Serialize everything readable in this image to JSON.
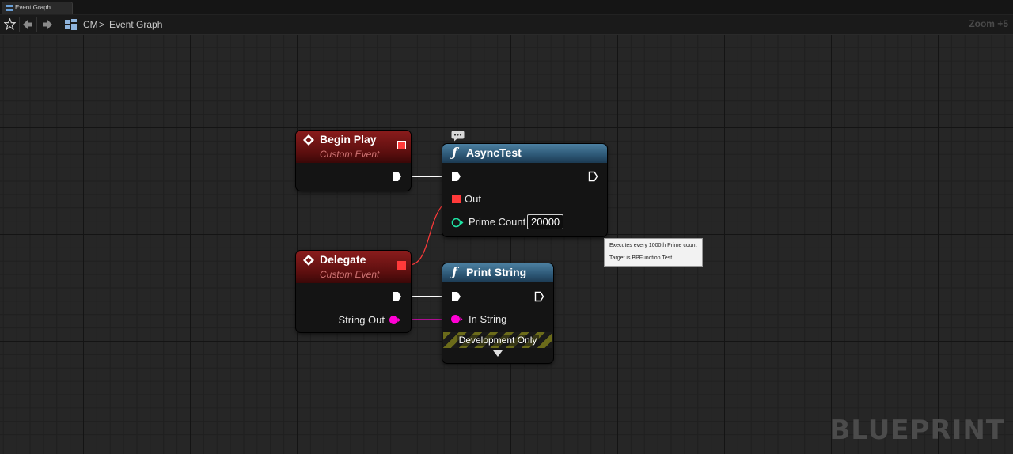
{
  "tab": {
    "label": "Event Graph"
  },
  "breadcrumb": {
    "root": "CM",
    "separator": ">",
    "current": "Event Graph"
  },
  "zoom": "Zoom +5",
  "watermark": "BLUEPRINT",
  "nodes": {
    "begin_play": {
      "title": "Begin Play",
      "subtitle": "Custom Event"
    },
    "delegate": {
      "title": "Delegate",
      "subtitle": "Custom Event",
      "string_out": "String Out"
    },
    "async_test": {
      "title": "AsyncTest",
      "out_label": "Out",
      "prime_count_label": "Prime Count",
      "prime_count_value": "20000"
    },
    "print_string": {
      "title": "Print String",
      "in_string_label": "In String",
      "dev_only": "Development Only"
    }
  },
  "tooltip": {
    "line1": "Executes every 1000th Prime count",
    "line2": "Target is BPFunction Test"
  },
  "colors": {
    "exec": "#ffffff",
    "delegate": "#ff3a3a",
    "string": "#ff00d4",
    "integer": "#1fe3a4"
  }
}
